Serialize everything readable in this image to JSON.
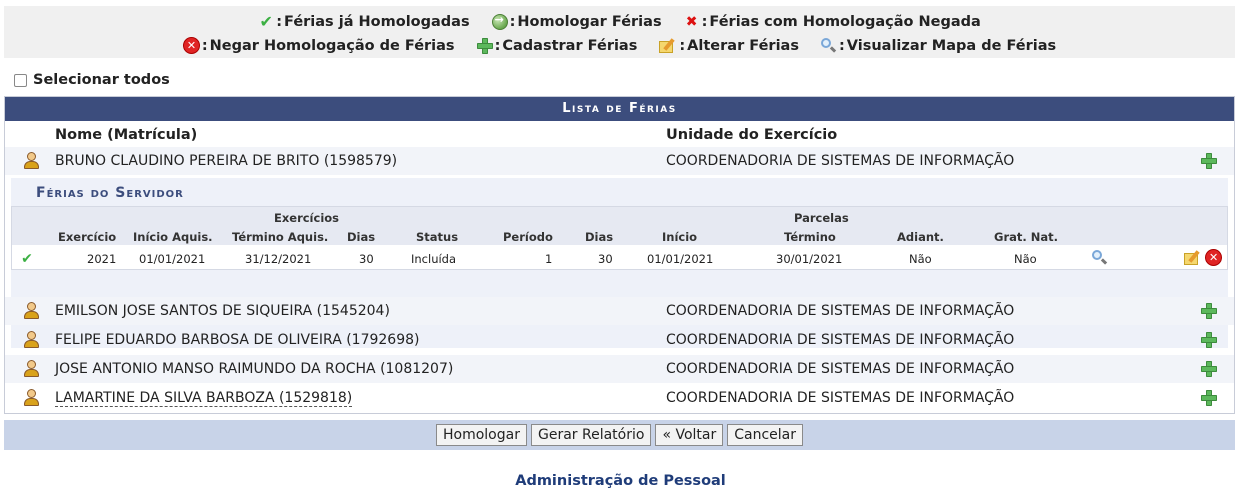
{
  "legend": {
    "homologadas": "Férias já Homologadas",
    "homologar": "Homologar Férias",
    "negada": "Férias com Homologação Negada",
    "negar": "Negar Homologação de Férias",
    "cadastrar": "Cadastrar Férias",
    "alterar": "Alterar Férias",
    "visualizar": "Visualizar Mapa de Férias",
    "colon": ":"
  },
  "select_all": "Selecionar todos",
  "list": {
    "caption": "Lista de Férias",
    "header_name": "Nome (Matrícula)",
    "header_unit": "Unidade do Exercício",
    "rows": [
      {
        "name": "BRUNO CLAUDINO PEREIRA DE BRITO (1598579)",
        "unit": "COORDENADORIA DE SISTEMAS DE INFORMAÇÃO"
      },
      {
        "name": "EMILSON JOSE SANTOS DE SIQUEIRA (1545204)",
        "unit": "COORDENADORIA DE SISTEMAS DE INFORMAÇÃO"
      },
      {
        "name": "FELIPE EDUARDO BARBOSA DE OLIVEIRA (1792698)",
        "unit": "COORDENADORIA DE SISTEMAS DE INFORMAÇÃO"
      },
      {
        "name": "JOSE ANTONIO MANSO RAIMUNDO DA ROCHA (1081207)",
        "unit": "COORDENADORIA DE SISTEMAS DE INFORMAÇÃO"
      },
      {
        "name": "LAMARTINE DA SILVA BARBOZA (1529818)",
        "unit": "COORDENADORIA DE SISTEMAS DE INFORMAÇÃO"
      }
    ]
  },
  "ferias": {
    "title": "Férias do Servidor",
    "group_exercicios": "Exercícios",
    "group_parcelas": "Parcelas",
    "headers": {
      "exercicio": "Exercício",
      "inicio_aquis": "Início Aquis.",
      "termino_aquis": "Término Aquis.",
      "dias": "Dias",
      "status": "Status",
      "periodo": "Período",
      "dias2": "Dias",
      "inicio": "Início",
      "termino": "Término",
      "adiant": "Adiant.",
      "grat_nat": "Grat. Nat."
    },
    "row": {
      "exercicio": "2021",
      "inicio_aquis": "01/01/2021",
      "termino_aquis": "31/12/2021",
      "dias": "30",
      "status": "Incluída",
      "periodo": "1",
      "dias2": "30",
      "inicio": "01/01/2021",
      "termino": "30/01/2021",
      "adiant": "Não",
      "grat_nat": "Não"
    }
  },
  "buttons": {
    "homologar": "Homologar",
    "gerar_relatorio": "Gerar Relatório",
    "voltar": "« Voltar",
    "cancelar": "Cancelar"
  },
  "footer": "Administração de Pessoal",
  "icons": [
    "check-icon",
    "green-arrow-circle-icon",
    "red-x-icon",
    "red-circle-x-icon",
    "green-plus-icon",
    "edit-icon",
    "magnifier-icon",
    "user-icon"
  ],
  "colors": {
    "caption_bg": "#3c4d7d",
    "button_bar": "#c8d3e8",
    "footer_text": "#1f3c79"
  }
}
